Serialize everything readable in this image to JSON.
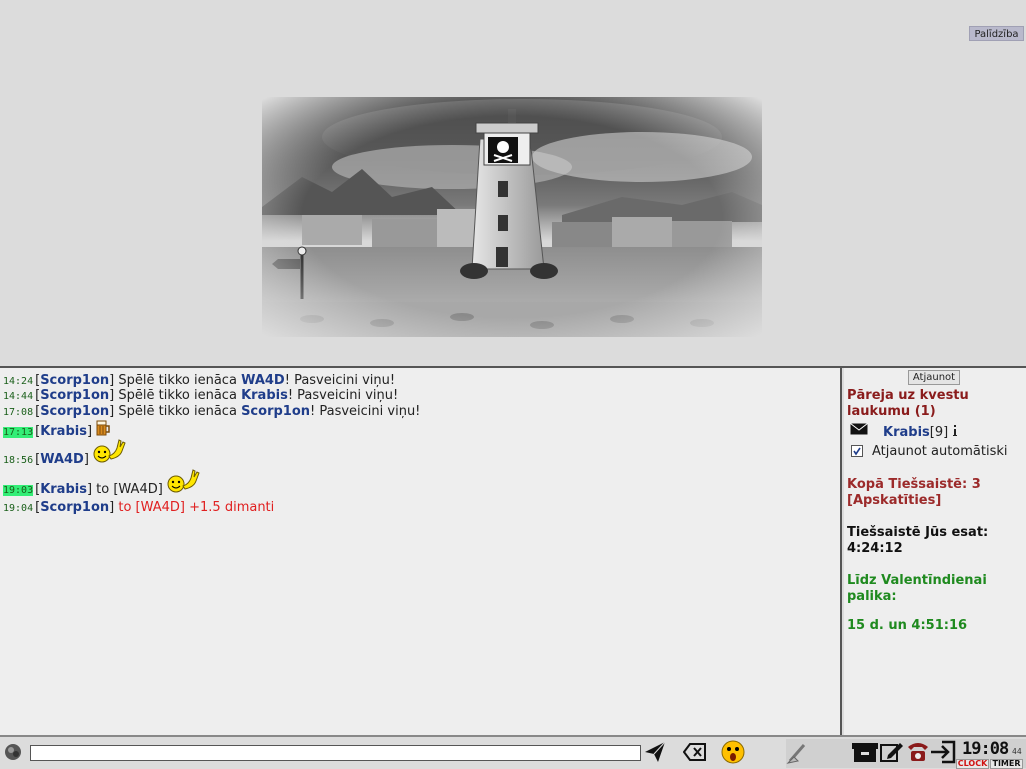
{
  "help": {
    "label": "Palīdzība"
  },
  "chat": {
    "messages": [
      {
        "time": "14:24",
        "highlight": false,
        "nick": "Scorp1on",
        "text": "Spēlē tikko ienāca ",
        "who": "WA4D",
        "tail": "! Pasveicini viņu!"
      },
      {
        "time": "14:44",
        "highlight": false,
        "nick": "Scorp1on",
        "text": "Spēlē tikko ienāca ",
        "who": "Krabis",
        "tail": "! Pasveicini viņu!"
      },
      {
        "time": "17:08",
        "highlight": false,
        "nick": "Scorp1on",
        "text": "Spēlē tikko ienāca ",
        "who": "Scorp1on",
        "tail": "! Pasveicini viņu!"
      },
      {
        "time": "17:13",
        "highlight": true,
        "nick": "Krabis",
        "emoticon": "beer-mug-icon"
      },
      {
        "time": "18:56",
        "highlight": false,
        "nick": "WA4D",
        "emoticon": "waving-smiley-icon"
      },
      {
        "time": "19:03",
        "highlight": true,
        "nick": "Krabis",
        "to": " to [WA4D]",
        "emoticon": "waving-smiley-icon"
      },
      {
        "time": "19:04",
        "highlight": false,
        "nick": "Scorp1on",
        "to": " to [WA4D] +1.5 dimanti"
      }
    ]
  },
  "sidebar": {
    "refresh_label": "Atjaunot",
    "quest_title": "Pāreja uz kvestu laukumu (1)",
    "mail_user": "Krabis",
    "mail_level": "[9]",
    "auto_refresh_label": "Atjaunot automātiski",
    "auto_refresh_checked": true,
    "total_online": "Kopā Tiešsaistē: 3",
    "view_link": "[Apskatīties]",
    "your_online_label": "Tiešsaistē Jūs esat:",
    "your_online_time": "4:24:12",
    "valentine_label": "Līdz Valentīndienai palika:",
    "valentine_time": "15 d. un 4:51:16"
  },
  "bottom": {
    "input_value": "",
    "clock": "19:08",
    "clock_seconds": "44",
    "clock_tab": "CLOCK",
    "timer_tab": "TIMER"
  },
  "colors": {
    "nick": "#1f3d8a",
    "timestamp_highlight": "#33ee77",
    "quest": "#8a1c1c",
    "valentine": "#1f8a1f",
    "whisper": "#e02020"
  }
}
